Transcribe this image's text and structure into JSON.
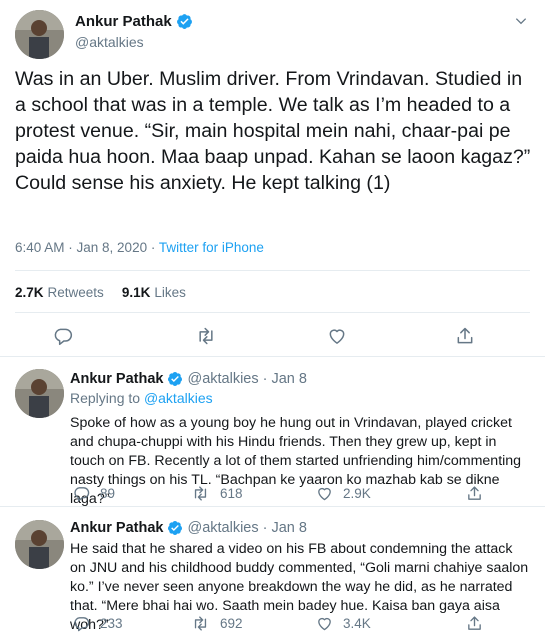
{
  "main_tweet": {
    "author_name": "Ankur Pathak",
    "author_handle": "@aktalkies",
    "verified": true,
    "text": "Was in an Uber. Muslim driver. From Vrindavan. Studied in a school that was in a temple. We talk as I’m headed to a protest venue. “Sir, main hospital mein nahi, chaar-pai pe paida hua hoon. Maa baap unpad. Kahan se laoon kagaz?” Could sense his anxiety. He kept talking (1)",
    "time": "6:40 AM · Jan 8, 2020 · ",
    "source": "Twitter for iPhone",
    "retweets_count": "2.7K",
    "retweets_label": "Retweets",
    "likes_count": "9.1K",
    "likes_label": "Likes"
  },
  "replies": [
    {
      "author_name": "Ankur Pathak",
      "author_handle": "@aktalkies",
      "date": "· Jan 8",
      "replying_prefix": "Replying to ",
      "replying_to": "@aktalkies",
      "text": "Spoke of how as a young boy he hung out in Vrindavan, played cricket and chupa-chuppi with his Hindu friends. Then they grew up, kept in touch on FB. Recently a lot of them started unfriending him/commenting nasty things on his TL. “Bachpan ke yaaron ko mazhab kab se dikne laga?”",
      "replies_count": "89",
      "retweets_count": "618",
      "likes_count": "2.9K"
    },
    {
      "author_name": "Ankur Pathak",
      "author_handle": "@aktalkies",
      "date": "· Jan 8",
      "text": "He said that he shared a video on his FB about condemning the attack on JNU and his childhood buddy commented, “Goli marni chahiye saalon ko.” I’ve never seen anyone breakdown the way he did, as he narrated that. “Mere bhai hai wo. Saath mein badey hue. Kaisa ban gaya aisa woh?”",
      "replies_count": "233",
      "retweets_count": "692",
      "likes_count": "3.4K"
    }
  ],
  "colors": {
    "accent": "#1da1f2",
    "secondary_text": "#657786",
    "border": "#e6ecf0"
  },
  "icons": [
    "verified-badge-icon",
    "chevron-down-icon",
    "reply-icon",
    "retweet-icon",
    "like-icon",
    "share-icon"
  ]
}
